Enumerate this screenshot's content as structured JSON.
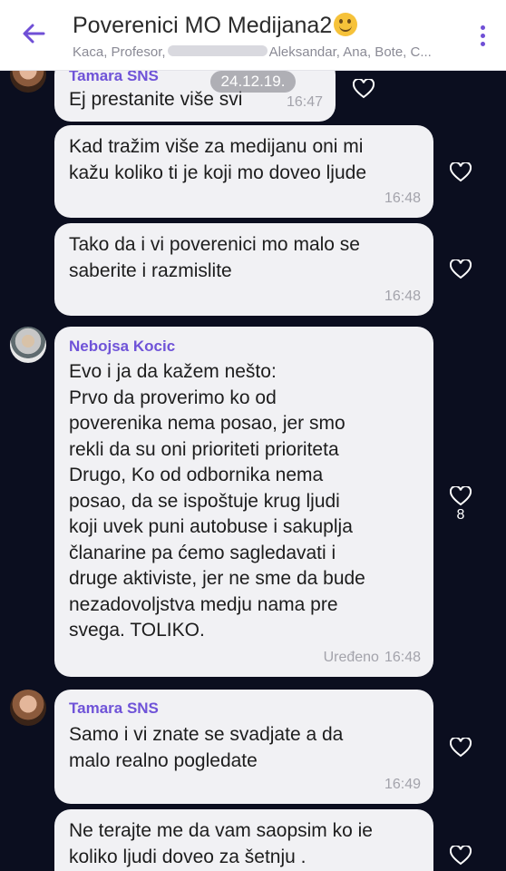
{
  "header": {
    "title": "Poverenici MO Medijana2",
    "emoji": "smiling-face-icon",
    "subtitle_start": "Kaca, Profesor,",
    "subtitle_end": "Aleksandar, Ana, Bote, C..."
  },
  "date_pill": "24.12.19.",
  "messages": [
    {
      "sender": "Tamara SNS",
      "text": "Ej prestanite više svi",
      "time": "16:47"
    },
    {
      "text": "Kad tražim više  za medijanu oni mi\nkažu koliko ti je koji mo doveo ljude",
      "time": "16:48"
    },
    {
      "text": "Tako da i vi poverenici mo malo se\nsaberite i razmislite",
      "time": "16:48"
    },
    {
      "sender": "Nebojsa Kocic",
      "text": "Evo i ja da kažem nešto:\nPrvo da proverimo ko od\npoverenika nema posao, jer smo\nrekli da su oni prioriteti prioriteta\nDrugo, Ko od odbornika nema\nposao, da se ispoštuje krug ljudi\nkoji uvek puni autobuse i sakuplja\nčlanarine pa ćemo sagledavati i\ndruge aktiviste, jer ne sme da bude\nnezadovoljstva medju nama pre\nsvega. TOLIKO.",
      "edited": "Uređeno",
      "time": "16:48",
      "likes": "8"
    },
    {
      "sender": "Tamara SNS",
      "text": "Samo i vi znate se svadjate a da\nmalo realno pogledate",
      "time": "16:49"
    },
    {
      "text": "Ne terajte me da vam saopsim ko ie\nkoliko ljudi doveo za šetnju ."
    }
  ],
  "colors": {
    "accent": "#6f53d8",
    "background": "#0b0e1f",
    "bubble": "#f1f1f4"
  }
}
